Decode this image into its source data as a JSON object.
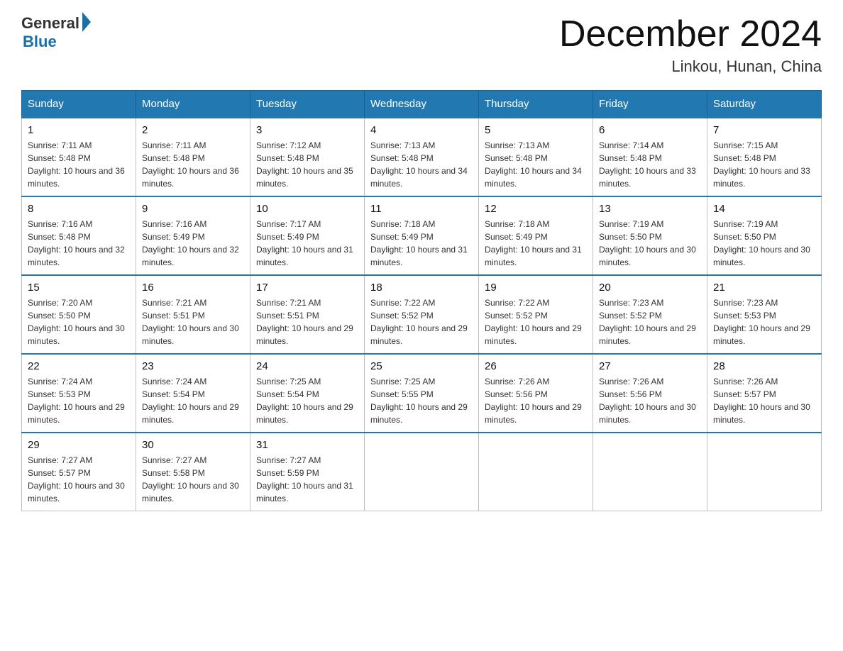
{
  "logo": {
    "general": "General",
    "blue": "Blue"
  },
  "title": "December 2024",
  "subtitle": "Linkou, Hunan, China",
  "weekdays": [
    "Sunday",
    "Monday",
    "Tuesday",
    "Wednesday",
    "Thursday",
    "Friday",
    "Saturday"
  ],
  "weeks": [
    [
      {
        "day": "1",
        "sunrise": "7:11 AM",
        "sunset": "5:48 PM",
        "daylight": "10 hours and 36 minutes."
      },
      {
        "day": "2",
        "sunrise": "7:11 AM",
        "sunset": "5:48 PM",
        "daylight": "10 hours and 36 minutes."
      },
      {
        "day": "3",
        "sunrise": "7:12 AM",
        "sunset": "5:48 PM",
        "daylight": "10 hours and 35 minutes."
      },
      {
        "day": "4",
        "sunrise": "7:13 AM",
        "sunset": "5:48 PM",
        "daylight": "10 hours and 34 minutes."
      },
      {
        "day": "5",
        "sunrise": "7:13 AM",
        "sunset": "5:48 PM",
        "daylight": "10 hours and 34 minutes."
      },
      {
        "day": "6",
        "sunrise": "7:14 AM",
        "sunset": "5:48 PM",
        "daylight": "10 hours and 33 minutes."
      },
      {
        "day": "7",
        "sunrise": "7:15 AM",
        "sunset": "5:48 PM",
        "daylight": "10 hours and 33 minutes."
      }
    ],
    [
      {
        "day": "8",
        "sunrise": "7:16 AM",
        "sunset": "5:48 PM",
        "daylight": "10 hours and 32 minutes."
      },
      {
        "day": "9",
        "sunrise": "7:16 AM",
        "sunset": "5:49 PM",
        "daylight": "10 hours and 32 minutes."
      },
      {
        "day": "10",
        "sunrise": "7:17 AM",
        "sunset": "5:49 PM",
        "daylight": "10 hours and 31 minutes."
      },
      {
        "day": "11",
        "sunrise": "7:18 AM",
        "sunset": "5:49 PM",
        "daylight": "10 hours and 31 minutes."
      },
      {
        "day": "12",
        "sunrise": "7:18 AM",
        "sunset": "5:49 PM",
        "daylight": "10 hours and 31 minutes."
      },
      {
        "day": "13",
        "sunrise": "7:19 AM",
        "sunset": "5:50 PM",
        "daylight": "10 hours and 30 minutes."
      },
      {
        "day": "14",
        "sunrise": "7:19 AM",
        "sunset": "5:50 PM",
        "daylight": "10 hours and 30 minutes."
      }
    ],
    [
      {
        "day": "15",
        "sunrise": "7:20 AM",
        "sunset": "5:50 PM",
        "daylight": "10 hours and 30 minutes."
      },
      {
        "day": "16",
        "sunrise": "7:21 AM",
        "sunset": "5:51 PM",
        "daylight": "10 hours and 30 minutes."
      },
      {
        "day": "17",
        "sunrise": "7:21 AM",
        "sunset": "5:51 PM",
        "daylight": "10 hours and 29 minutes."
      },
      {
        "day": "18",
        "sunrise": "7:22 AM",
        "sunset": "5:52 PM",
        "daylight": "10 hours and 29 minutes."
      },
      {
        "day": "19",
        "sunrise": "7:22 AM",
        "sunset": "5:52 PM",
        "daylight": "10 hours and 29 minutes."
      },
      {
        "day": "20",
        "sunrise": "7:23 AM",
        "sunset": "5:52 PM",
        "daylight": "10 hours and 29 minutes."
      },
      {
        "day": "21",
        "sunrise": "7:23 AM",
        "sunset": "5:53 PM",
        "daylight": "10 hours and 29 minutes."
      }
    ],
    [
      {
        "day": "22",
        "sunrise": "7:24 AM",
        "sunset": "5:53 PM",
        "daylight": "10 hours and 29 minutes."
      },
      {
        "day": "23",
        "sunrise": "7:24 AM",
        "sunset": "5:54 PM",
        "daylight": "10 hours and 29 minutes."
      },
      {
        "day": "24",
        "sunrise": "7:25 AM",
        "sunset": "5:54 PM",
        "daylight": "10 hours and 29 minutes."
      },
      {
        "day": "25",
        "sunrise": "7:25 AM",
        "sunset": "5:55 PM",
        "daylight": "10 hours and 29 minutes."
      },
      {
        "day": "26",
        "sunrise": "7:26 AM",
        "sunset": "5:56 PM",
        "daylight": "10 hours and 29 minutes."
      },
      {
        "day": "27",
        "sunrise": "7:26 AM",
        "sunset": "5:56 PM",
        "daylight": "10 hours and 30 minutes."
      },
      {
        "day": "28",
        "sunrise": "7:26 AM",
        "sunset": "5:57 PM",
        "daylight": "10 hours and 30 minutes."
      }
    ],
    [
      {
        "day": "29",
        "sunrise": "7:27 AM",
        "sunset": "5:57 PM",
        "daylight": "10 hours and 30 minutes."
      },
      {
        "day": "30",
        "sunrise": "7:27 AM",
        "sunset": "5:58 PM",
        "daylight": "10 hours and 30 minutes."
      },
      {
        "day": "31",
        "sunrise": "7:27 AM",
        "sunset": "5:59 PM",
        "daylight": "10 hours and 31 minutes."
      },
      null,
      null,
      null,
      null
    ]
  ]
}
